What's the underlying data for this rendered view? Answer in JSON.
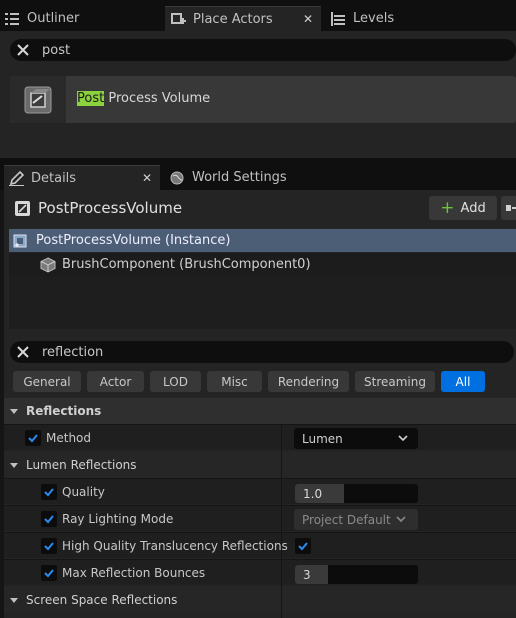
{
  "top_tabs": [
    {
      "label": "Outliner",
      "icon": "list-icon"
    },
    {
      "label": "Place Actors",
      "icon": "place-actors-icon"
    },
    {
      "label": "Levels",
      "icon": "levels-icon"
    }
  ],
  "place_search": {
    "value": "post"
  },
  "actor_result": {
    "highlight": "Post",
    "rest": " Process Volume"
  },
  "details_tabs": [
    {
      "label": "Details",
      "icon": "pencil-icon"
    },
    {
      "label": "World Settings",
      "icon": "globe-icon"
    }
  ],
  "actor_header": {
    "name": "PostProcessVolume",
    "add_label": "Add"
  },
  "components": [
    {
      "label": "PostProcessVolume (Instance)"
    },
    {
      "label": "BrushComponent (BrushComponent0)"
    }
  ],
  "detail_search": {
    "value": "reflection"
  },
  "filter_buttons": [
    "General",
    "Actor",
    "LOD",
    "Misc",
    "Rendering",
    "Streaming",
    "All"
  ],
  "active_filter": "All",
  "categories": {
    "reflections": "Reflections",
    "lumen_reflections": "Lumen Reflections",
    "screen_space": "Screen Space Reflections"
  },
  "properties": {
    "method": {
      "label": "Method",
      "value": "Lumen",
      "enabled": true
    },
    "quality": {
      "label": "Quality",
      "value": "1.0",
      "enabled": true,
      "fill": 0.4
    },
    "ray_lighting": {
      "label": "Ray Lighting Mode",
      "value": "Project Default",
      "enabled": true
    },
    "hq_translucency": {
      "label": "High Quality Translucency Reflections",
      "checked": true,
      "enabled": true
    },
    "max_bounces": {
      "label": "Max Reflection Bounces",
      "value": "3",
      "enabled": true,
      "fill": 0.27
    }
  },
  "colors": {
    "accent": "#0070e0",
    "highlight": "#8bd23c",
    "selection": "#4c5e75"
  }
}
